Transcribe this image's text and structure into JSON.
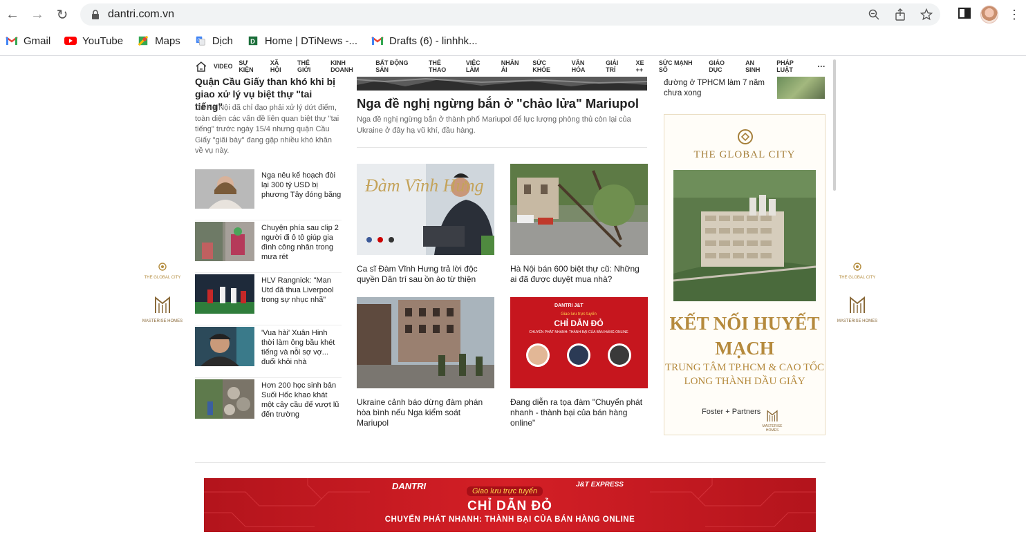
{
  "browser": {
    "url": "dantri.com.vn",
    "bookmarks": [
      {
        "label": "Gmail",
        "icon": "gmail-icon"
      },
      {
        "label": "YouTube",
        "icon": "youtube-icon"
      },
      {
        "label": "Maps",
        "icon": "maps-icon"
      },
      {
        "label": "Dịch",
        "icon": "translate-icon"
      },
      {
        "label": "Home | DTiNews -...",
        "icon": "dtinews-icon"
      },
      {
        "label": "Drafts (6) - linhhk...",
        "icon": "gmail-icon"
      }
    ]
  },
  "nav": {
    "items": [
      "VIDEO",
      "SỰ KIỆN",
      "XÃ HỘI",
      "THẾ GIỚI",
      "KINH DOANH",
      "BẤT ĐỘNG SẢN",
      "THỂ THAO",
      "VIỆC LÀM",
      "NHÂN ÁI",
      "SỨC KHỎE",
      "VĂN HÓA",
      "GIẢI TRÍ",
      "XE ++",
      "SỨC MẠNH SỐ",
      "GIÁO DỤC",
      "AN SINH",
      "PHÁP LUẬT"
    ],
    "more": "···"
  },
  "side_ads": {
    "global_city": "THE GLOBAL CITY",
    "masterise": "MASTERISE HOMES"
  },
  "left": {
    "lead_title": "Quận Cầu Giấy than khó khi bị giao xử lý vụ biệt thự \"tai tiếng\"",
    "lead_desc": "Dù Hà Nội đã chỉ đạo phải xử lý dứt điểm, toàn diện các vấn đề liên quan biệt thự \"tai tiếng\" trước ngày 15/4 nhưng quận Cầu Giấy \"giãi bày\" đang gặp nhiều khó khăn về vụ này.",
    "items": [
      "Nga nêu kế hoạch đòi lại 300 tỷ USD bị phương Tây đóng băng",
      "Chuyện phía sau clip 2 người đi ô tô giúp gia đình công nhân trong mưa rét",
      "HLV Rangnick: \"Man Utd đã thua Liverpool trong sự nhục nhã\"",
      "'Vua hài' Xuân Hinh thời làm ông bầu khét tiếng và nỗi sợ vợ... đuổi khỏi nhà",
      "Hơn 200 học sinh bản Suối Hốc khao khát một cây cầu để vượt lũ đến trường"
    ]
  },
  "center": {
    "hero_title": "Nga đề nghị ngừng bắn ở \"chảo lửa\" Mariupol",
    "hero_desc": "Nga đề nghị ngừng bắn ở thành phố Mariupol để lực lượng phòng thủ còn lại của Ukraine ở đây hạ vũ khí, đầu hàng.",
    "cards": [
      "Ca sĩ Đàm Vĩnh Hưng trả lời độc quyền Dân trí sau ồn ào từ thiện",
      "Hà Nội bán 600 biệt thự cũ: Những ai đã được duyệt mua nhà?",
      "Ukraine cảnh báo dừng đàm phán hòa bình nếu Nga kiểm soát Mariupol",
      "Đang diễn ra tọa đàm \"Chuyển phát nhanh - thành bại của bán hàng online\""
    ],
    "card1_overlay": "Đàm Vĩnh Hưng",
    "card4_overlay": {
      "top": "DANTRI  J&T",
      "tag": "Giao lưu trực tuyến",
      "title": "CHỈ DẪN ĐỎ",
      "sub": "CHUYỂN PHÁT NHANH: THÀNH BẠI CỦA BÁN HÀNG ONLINE"
    }
  },
  "right": {
    "top_text": "đường ở TPHCM làm 7 năm chưa xong",
    "ad_title": "THE GLOBAL CITY",
    "ad_h1": "KẾT NỐI HUYẾT MẠCH",
    "ad_h2": "TRUNG TÂM TP.HCM & CAO TỐC LONG THÀNH DẦU GIÂY",
    "ad_foster": "Foster + Partners",
    "ad_masterise": "MASTERISE HOMES"
  },
  "banner": {
    "logo_left": "DANTRI",
    "logo_right": "J&T EXPRESS",
    "tag": "Giao lưu trực tuyến",
    "title": "CHỈ DẪN ĐỎ",
    "subtitle": "CHUYỂN PHÁT NHANH: THÀNH BẠI CỦA BÁN HÀNG ONLINE"
  }
}
